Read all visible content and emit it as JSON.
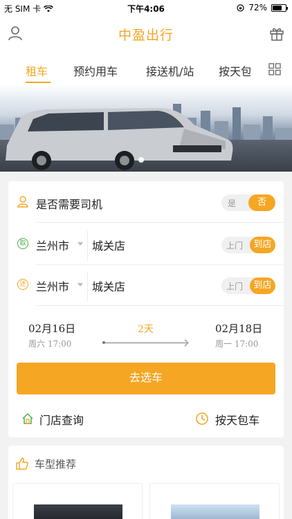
{
  "status_bar": {
    "carrier": "无 SIM 卡",
    "time": "下午4:06",
    "battery_text": "72%",
    "battery_level": 0.72
  },
  "header": {
    "title": "中盈出行",
    "icons": {
      "left": "user-icon",
      "right": "gift-icon"
    }
  },
  "tabs": {
    "items": [
      {
        "label": "租车",
        "active": true
      },
      {
        "label": "预约用车",
        "active": false
      },
      {
        "label": "接送机/站",
        "active": false
      },
      {
        "label": "按天包车",
        "active": false
      }
    ],
    "menu_icon": "grid-icon"
  },
  "banner": {
    "slide_count": 1,
    "current_slide": 1
  },
  "booking": {
    "driver": {
      "label": "是否需要司机",
      "options": [
        "是",
        "否"
      ],
      "selected": "否"
    },
    "pickup": {
      "badge": "取",
      "city": "兰州市",
      "store": "城关店",
      "options": [
        "上门",
        "到店"
      ],
      "selected": "到店"
    },
    "return": {
      "badge": "还",
      "city": "兰州市",
      "store": "城关店",
      "options": [
        "上门",
        "到店"
      ],
      "selected": "到店"
    },
    "dates": {
      "start_date": "02月16日",
      "start_sub": "周六 17:00",
      "duration": "2天",
      "end_date": "02月18日",
      "end_sub": "周一 17:00"
    },
    "cta": "去选车",
    "links": {
      "store_query": "门店查询",
      "daily_charter": "按天包车"
    }
  },
  "recommend": {
    "title": "车型推荐"
  },
  "colors": {
    "accent": "#f5a623",
    "green": "#4caf50",
    "text": "#222222",
    "muted": "#999999"
  }
}
